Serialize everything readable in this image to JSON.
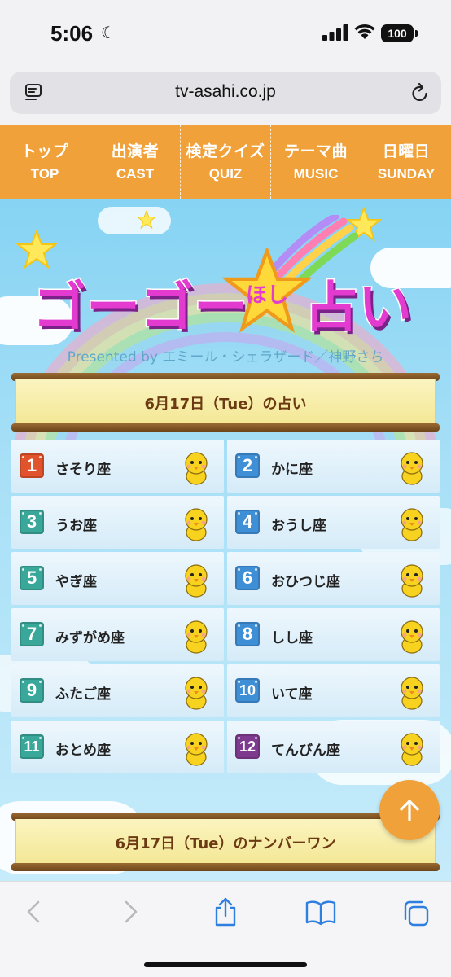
{
  "status_bar": {
    "time": "5:06",
    "battery": "100"
  },
  "browser": {
    "url": "tv-asahi.co.jp"
  },
  "nav": [
    {
      "ja": "トップ",
      "en": "TOP"
    },
    {
      "ja": "出演者",
      "en": "CAST"
    },
    {
      "ja": "検定クイズ",
      "en": "QUIZ"
    },
    {
      "ja": "テーマ曲",
      "en": "MUSIC"
    },
    {
      "ja": "日曜日",
      "en": "SUNDAY"
    }
  ],
  "logo": {
    "part1": "ゴーゴー",
    "star": "ほし",
    "part2": "占い",
    "presented": "Presented by エミール・シェラザード／神野さち"
  },
  "section1": {
    "title": "6月17日（Tue）の占い"
  },
  "rankings": [
    {
      "rank": "1",
      "sign": "さそり座",
      "color": "#e0532c"
    },
    {
      "rank": "2",
      "sign": "かに座",
      "color": "#3f8fd6"
    },
    {
      "rank": "3",
      "sign": "うお座",
      "color": "#3aa79b"
    },
    {
      "rank": "4",
      "sign": "おうし座",
      "color": "#3f8fd6"
    },
    {
      "rank": "5",
      "sign": "やぎ座",
      "color": "#3aa79b"
    },
    {
      "rank": "6",
      "sign": "おひつじ座",
      "color": "#3f8fd6"
    },
    {
      "rank": "7",
      "sign": "みずがめ座",
      "color": "#3aa79b"
    },
    {
      "rank": "8",
      "sign": "しし座",
      "color": "#3f8fd6"
    },
    {
      "rank": "9",
      "sign": "ふたご座",
      "color": "#3aa79b"
    },
    {
      "rank": "10",
      "sign": "いて座",
      "color": "#3f8fd6"
    },
    {
      "rank": "11",
      "sign": "おとめ座",
      "color": "#3aa79b"
    },
    {
      "rank": "12",
      "sign": "てんびん座",
      "color": "#7e3a8f"
    }
  ],
  "section2": {
    "title": "6月17日（Tue）のナンバーワン"
  },
  "icons": {
    "scroll_top": "arrow-up-icon",
    "toolbar": [
      "back-icon",
      "forward-icon",
      "share-icon",
      "bookmarks-icon",
      "tabs-icon"
    ]
  }
}
